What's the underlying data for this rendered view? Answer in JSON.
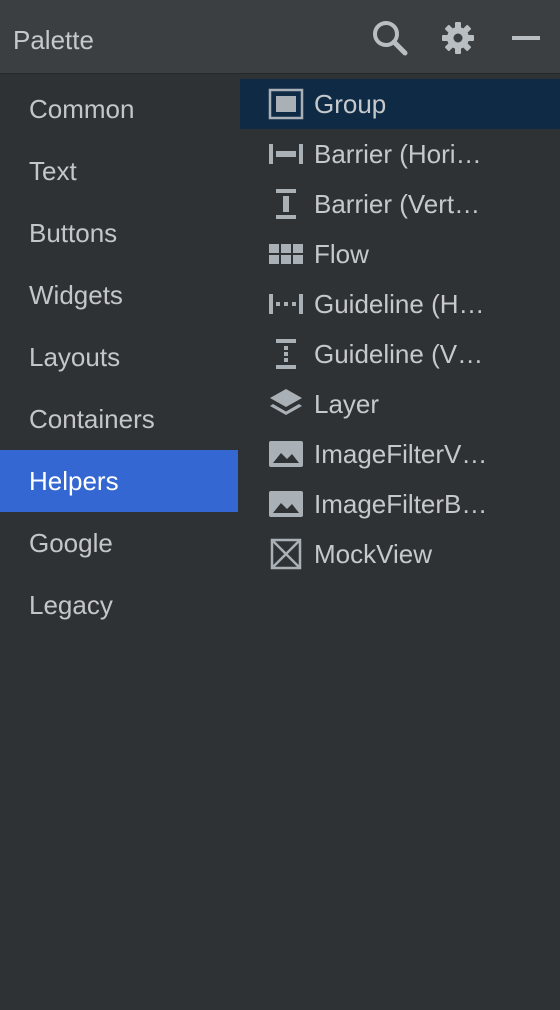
{
  "header": {
    "title": "Palette",
    "search_icon": "search-icon",
    "settings_icon": "gear-icon",
    "minimize_icon": "minimize-icon"
  },
  "categories": [
    {
      "label": "Common",
      "selected": false
    },
    {
      "label": "Text",
      "selected": false
    },
    {
      "label": "Buttons",
      "selected": false
    },
    {
      "label": "Widgets",
      "selected": false
    },
    {
      "label": "Layouts",
      "selected": false
    },
    {
      "label": "Containers",
      "selected": false
    },
    {
      "label": "Helpers",
      "selected": true
    },
    {
      "label": "Google",
      "selected": false
    },
    {
      "label": "Legacy",
      "selected": false
    }
  ],
  "components": [
    {
      "label": "Group",
      "icon": "group-icon",
      "selected": true
    },
    {
      "label": "Barrier (Hori…",
      "icon": "barrier-horizontal-icon",
      "selected": false
    },
    {
      "label": "Barrier (Vert…",
      "icon": "barrier-vertical-icon",
      "selected": false
    },
    {
      "label": "Flow",
      "icon": "flow-icon",
      "selected": false
    },
    {
      "label": "Guideline (H…",
      "icon": "guideline-horizontal-icon",
      "selected": false
    },
    {
      "label": "Guideline (V…",
      "icon": "guideline-vertical-icon",
      "selected": false
    },
    {
      "label": "Layer",
      "icon": "layer-icon",
      "selected": false
    },
    {
      "label": "ImageFilterV…",
      "icon": "image-icon",
      "selected": false
    },
    {
      "label": "ImageFilterB…",
      "icon": "image-icon",
      "selected": false
    },
    {
      "label": "MockView",
      "icon": "mockview-icon",
      "selected": false
    }
  ],
  "colors": {
    "background": "#2f3234",
    "header_background": "#3b3f42",
    "category_selected": "#3467d1",
    "component_selected": "#0e2a45",
    "icon": "#a9b1b7"
  }
}
